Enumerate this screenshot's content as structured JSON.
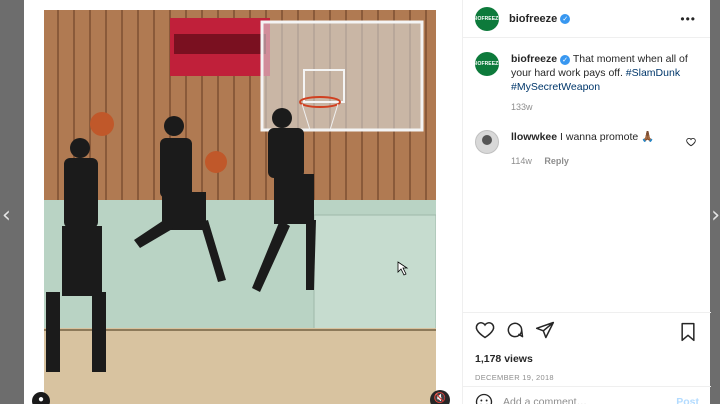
{
  "post": {
    "username": "biofreeze",
    "logo_text": "BIOFREEZE",
    "caption": "That moment when all of your hard work pays off.",
    "hashtags": "#SlamDunk #MySecretWeapon",
    "caption_age": "133w",
    "views": "1,178 views",
    "date": "DECEMBER 19, 2018"
  },
  "comments": [
    {
      "username": "llowwkee",
      "text": "I wanna promote 🙏🏾",
      "age": "114w",
      "reply_label": "Reply"
    }
  ],
  "comment_box": {
    "placeholder": "Add a comment…",
    "post_label": "Post"
  },
  "nav": {
    "prev_glyph": "‹",
    "next_glyph": "›"
  },
  "icons": {
    "verified": "verified-badge-icon",
    "more": "more-options-icon",
    "like": "heart-icon",
    "comment": "comment-icon",
    "share": "share-icon",
    "save": "bookmark-icon",
    "emoji": "emoji-icon",
    "mute": "speaker-muted-icon"
  },
  "colors": {
    "brand_green": "#0d7a3b",
    "verified_blue": "#3897f0",
    "hashtag": "#00376b",
    "muted": "#8e8e8e"
  }
}
